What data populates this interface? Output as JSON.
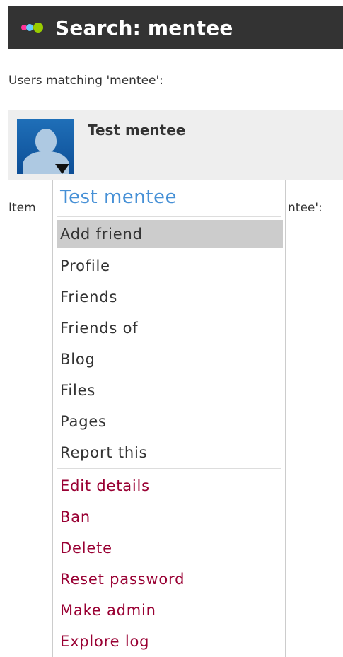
{
  "header": {
    "title": "Search: mentee"
  },
  "results": {
    "users_heading": "Users matching 'mentee':"
  },
  "user": {
    "name": "Test mentee"
  },
  "items_heading": {
    "left_visible": "Item",
    "right_visible": "ntee':"
  },
  "menu": {
    "title": "Test mentee",
    "items": [
      {
        "label": "Add friend"
      },
      {
        "label": "Profile"
      },
      {
        "label": "Friends"
      },
      {
        "label": "Friends of"
      },
      {
        "label": "Blog"
      },
      {
        "label": "Files"
      },
      {
        "label": "Pages"
      },
      {
        "label": "Report this"
      }
    ],
    "admin_items": [
      {
        "label": "Edit details"
      },
      {
        "label": "Ban"
      },
      {
        "label": "Delete"
      },
      {
        "label": "Reset password"
      },
      {
        "label": "Make admin"
      },
      {
        "label": "Explore log"
      }
    ]
  },
  "icons": {
    "logo": "elgg-dots-icon",
    "avatar": "default-user-avatar-icon",
    "menu_toggle": "triangle-down-icon"
  },
  "colors": {
    "header_bg": "#333333",
    "link_blue": "#4690d6",
    "admin_red": "#990033",
    "hover_bg": "#cccccc",
    "row_bg": "#eeeeee"
  }
}
